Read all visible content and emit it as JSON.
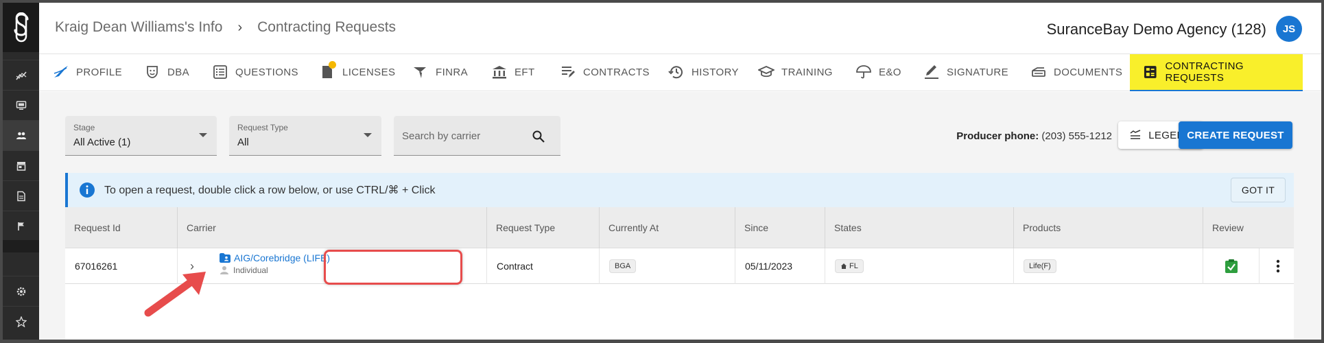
{
  "header": {
    "breadcrumb_parent": "Kraig Dean Williams's Info",
    "breadcrumb_current": "Contracting Requests",
    "agency": "SuranceBay Demo Agency (128)",
    "avatar_initials": "JS"
  },
  "tabs": [
    {
      "label": "PROFILE",
      "icon": "profile-icon"
    },
    {
      "label": "DBA",
      "icon": "mask-icon"
    },
    {
      "label": "QUESTIONS",
      "icon": "list-icon"
    },
    {
      "label": "LICENSES",
      "icon": "license-icon"
    },
    {
      "label": "FINRA",
      "icon": "finra-icon"
    },
    {
      "label": "EFT",
      "icon": "bank-icon"
    },
    {
      "label": "CONTRACTS",
      "icon": "contracts-icon"
    },
    {
      "label": "HISTORY",
      "icon": "history-icon"
    },
    {
      "label": "TRAINING",
      "icon": "training-icon"
    },
    {
      "label": "E&O",
      "icon": "umbrella-icon"
    },
    {
      "label": "SIGNATURE",
      "icon": "pen-icon"
    },
    {
      "label": "DOCUMENTS",
      "icon": "documents-icon"
    },
    {
      "label": "CONTRACTING REQUESTS",
      "icon": "requests-icon",
      "active": true
    }
  ],
  "filters": {
    "stage_label": "Stage",
    "stage_value": "All Active (1)",
    "request_type_label": "Request Type",
    "request_type_value": "All",
    "search_placeholder": "Search by carrier"
  },
  "toolbar": {
    "phone_label": "Producer phone:",
    "phone_value": "(203) 555-1212",
    "legend_label": "LEGEND",
    "create_label": "CREATE REQUEST"
  },
  "banner": {
    "text": "To open a request, double click a row below, or use CTRL/⌘ + Click",
    "got_it_label": "GOT IT"
  },
  "table": {
    "columns": [
      "Request Id",
      "Carrier",
      "Request Type",
      "Currently At",
      "Since",
      "States",
      "Products",
      "Review"
    ],
    "rows": [
      {
        "request_id": "67016261",
        "carrier_name": "AIG/Corebridge (LIFE)",
        "carrier_sub": "Individual",
        "request_type": "Contract",
        "currently_at": "BGA",
        "since": "05/11/2023",
        "states": "FL",
        "products": "Life(F)"
      }
    ]
  },
  "colors": {
    "accent": "#1976d2",
    "active_tab": "#f9ef2b",
    "highlight": "#e74c4c",
    "rail": "#2b2b2b"
  }
}
